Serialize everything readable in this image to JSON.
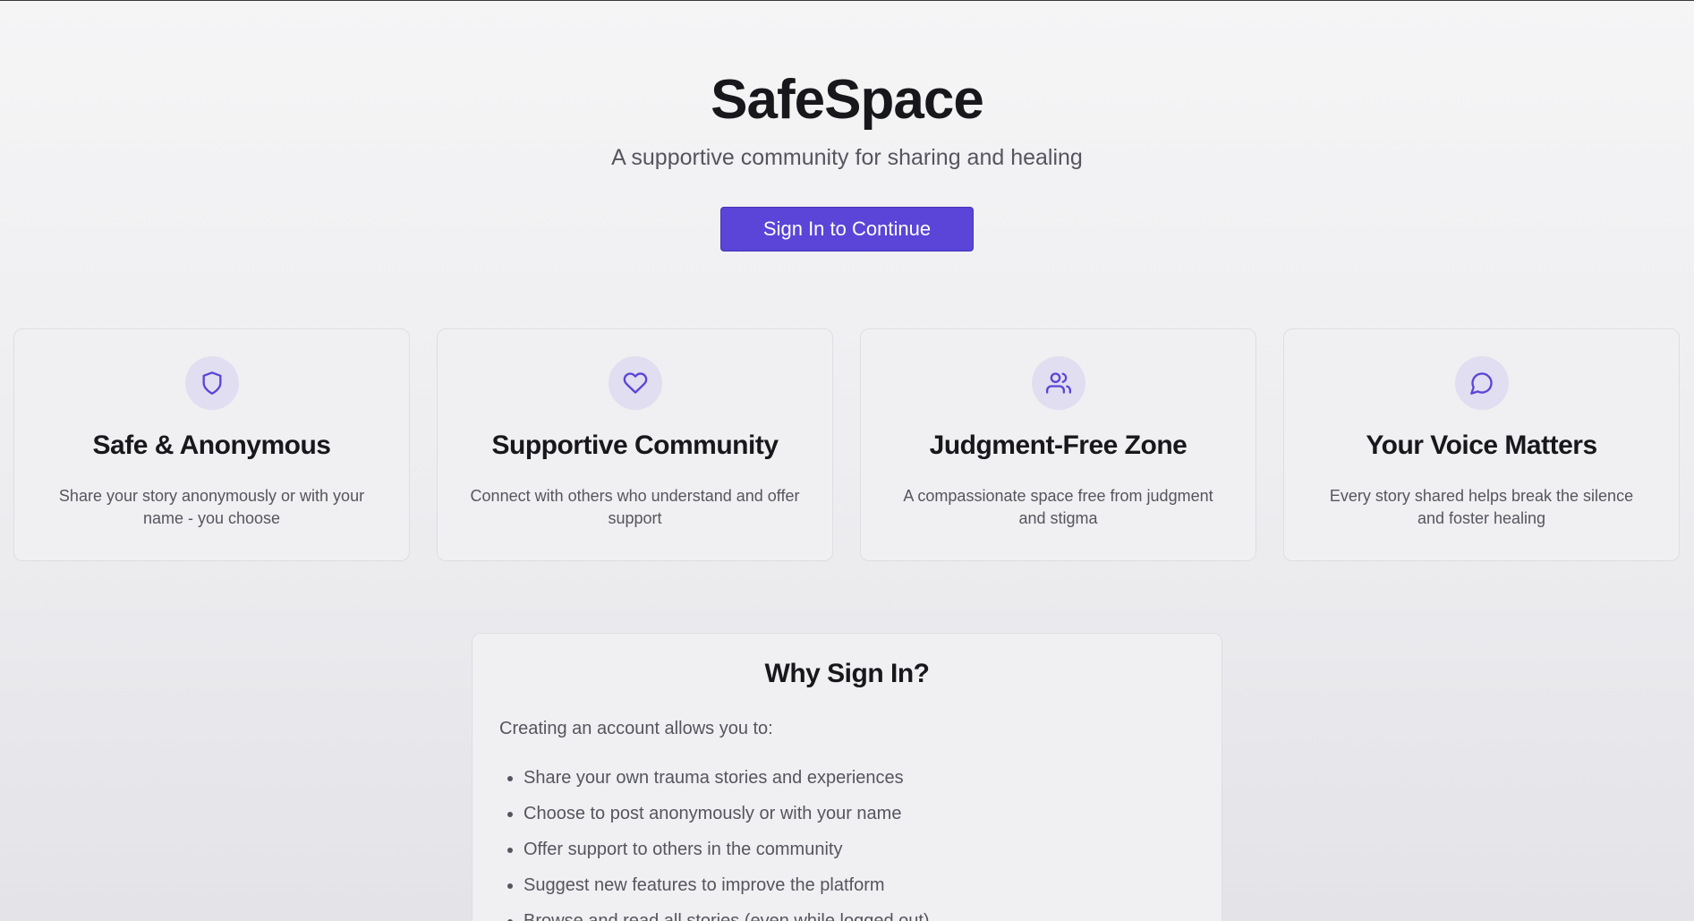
{
  "hero": {
    "title": "SafeSpace",
    "subtitle": "A supportive community for sharing and healing",
    "signin_label": "Sign In to Continue"
  },
  "features": [
    {
      "icon": "shield-icon",
      "title": "Safe & Anonymous",
      "description": "Share your story anonymously or with your name - you choose"
    },
    {
      "icon": "heart-icon",
      "title": "Supportive Community",
      "description": "Connect with others who understand and offer support"
    },
    {
      "icon": "users-icon",
      "title": "Judgment-Free Zone",
      "description": "A compassionate space free from judgment and stigma"
    },
    {
      "icon": "message-circle-icon",
      "title": "Your Voice Matters",
      "description": "Every story shared helps break the silence and foster healing"
    }
  ],
  "why": {
    "title": "Why Sign In?",
    "intro": "Creating an account allows you to:",
    "items": [
      "Share your own trauma stories and experiences",
      "Choose to post anonymously or with your name",
      "Offer support to others in the community",
      "Suggest new features to improve the platform",
      "Browse and read all stories (even while logged out)"
    ]
  },
  "colors": {
    "accent": "#5a45d8",
    "icon_bg": "#e0def0",
    "icon_stroke": "#5a45d8"
  }
}
